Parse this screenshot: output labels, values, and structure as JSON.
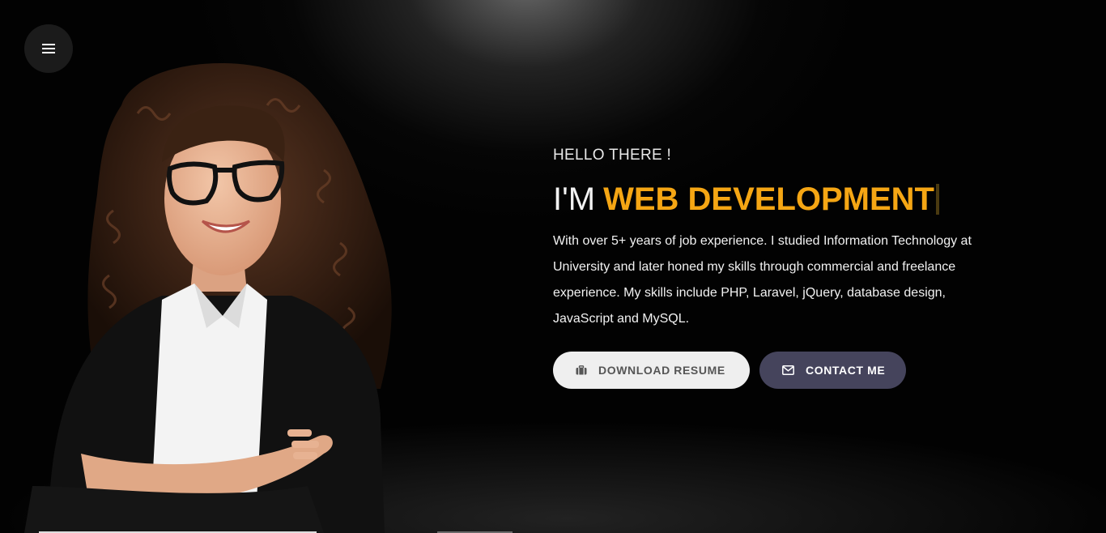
{
  "menu": {
    "icon": "hamburger-menu-icon"
  },
  "hero": {
    "greeting": "HELLO THERE !",
    "headline_prefix": "I'M",
    "headline_role": "WEB DEVELOPMENT",
    "bio": "With over 5+ years of job experience. I studied Information Technology at University and later honed my skills through commercial and freelance experience. My skills include PHP, Laravel, jQuery, database design, JavaScript and MySQL.",
    "accent_color": "#f5a614"
  },
  "actions": {
    "download_resume": {
      "label": "DOWNLOAD RESUME",
      "icon": "briefcase-icon"
    },
    "contact_me": {
      "label": "CONTACT ME",
      "icon": "envelope-icon"
    }
  }
}
